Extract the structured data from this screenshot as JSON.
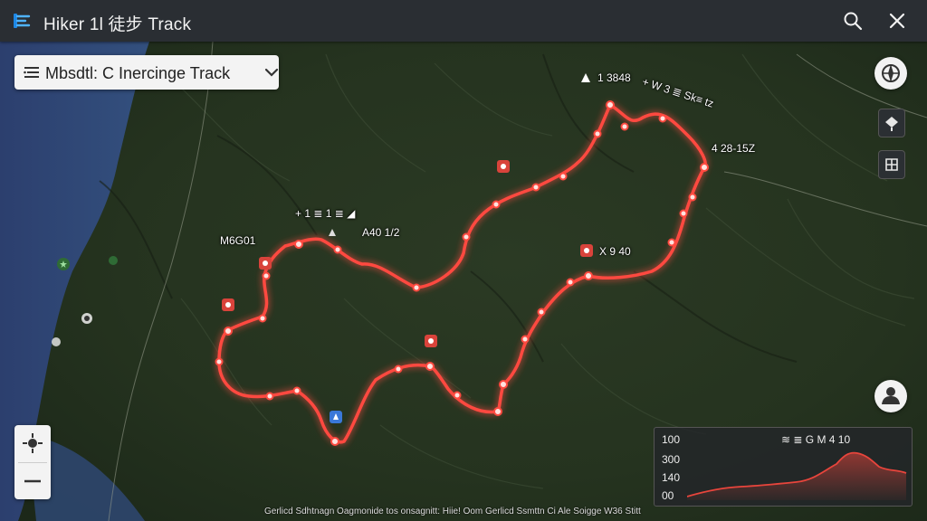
{
  "app": {
    "title": "Hiker 1l 徒步 Track",
    "icons": {
      "logo": "track-logo-icon",
      "search": "search-icon",
      "close": "close-icon"
    }
  },
  "track_selector": {
    "label": "Mbsdtl: C Inercinge Track",
    "icons": {
      "menu": "list-icon",
      "expand": "chevron-down-icon"
    }
  },
  "map_labels": {
    "peak_a": "1 3848",
    "peak_b": "+ W 3 ≣ Sk≡ tz",
    "peak_c": "4 28-15Z",
    "waypoint_a": "+ 1 ≣ 1 ≣ ◢",
    "waypoint_b": "A40 1/2",
    "waypoint_c": "M6G01",
    "waypoint_d": "X 9 40"
  },
  "map_controls": {
    "icons": [
      "compass-icon",
      "layers-icon",
      "map-type-icon",
      "user-icon"
    ]
  },
  "zoom": {
    "in_icon": "locate-icon",
    "out_label": "—"
  },
  "elevation": {
    "title": "≋ ≣ G M 4 10",
    "y_ticks": [
      "100",
      "300",
      "140",
      "00"
    ],
    "line_color": "#e8453c"
  },
  "footer": {
    "attribution": "Gerlicd Sdhtnagn Oagmonide tos onsagnitt: Hiie! Oom Gerlicd Ssmttn Ci Ale Soigge W36 Stitt"
  },
  "colors": {
    "track": "#ff4a40",
    "topbar": "#2a2e33",
    "marker": "#d9433b"
  }
}
